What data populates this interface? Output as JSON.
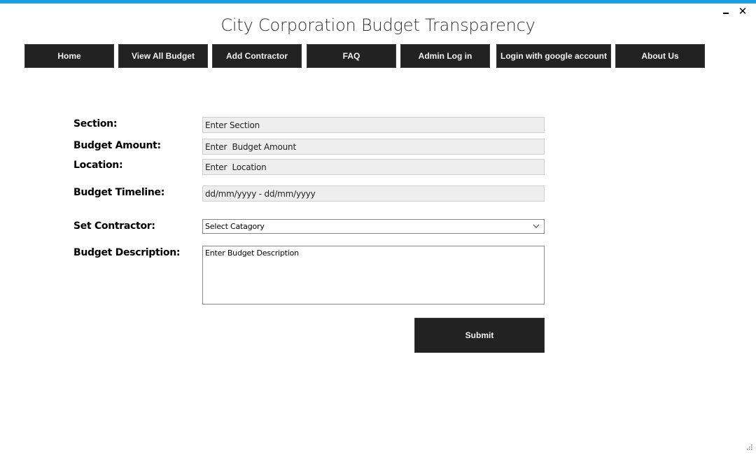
{
  "window": {
    "title": "City Corporation Budget Transparency",
    "minimize_icon": "minimize-icon",
    "close_icon": "close-icon",
    "close_glyph": "✕",
    "accent_color": "#1ba1e2"
  },
  "nav": {
    "items": [
      {
        "label": "Home"
      },
      {
        "label": "View All Budget"
      },
      {
        "label": "Add Contractor"
      },
      {
        "label": "FAQ"
      },
      {
        "label": "Admin Log in"
      },
      {
        "label": "Login with google account"
      },
      {
        "label": "About Us"
      }
    ],
    "button_color": "#222222"
  },
  "form": {
    "section": {
      "label": "Section:",
      "placeholder": "Enter Section"
    },
    "budget_amount": {
      "label": "Budget Amount:",
      "placeholder": "Enter  Budget Amount"
    },
    "location": {
      "label": "Location:",
      "placeholder": "Enter  Location"
    },
    "budget_timeline": {
      "label": "Budget Timeline:",
      "placeholder": "dd/mm/yyyy - dd/mm/yyyy"
    },
    "set_contractor": {
      "label": "Set Contractor:",
      "selected": "Select Catagory",
      "icon": "chevron-down-icon"
    },
    "budget_description": {
      "label": "Budget Description:",
      "placeholder": "Enter Budget Description"
    },
    "submit_label": "Submit"
  }
}
